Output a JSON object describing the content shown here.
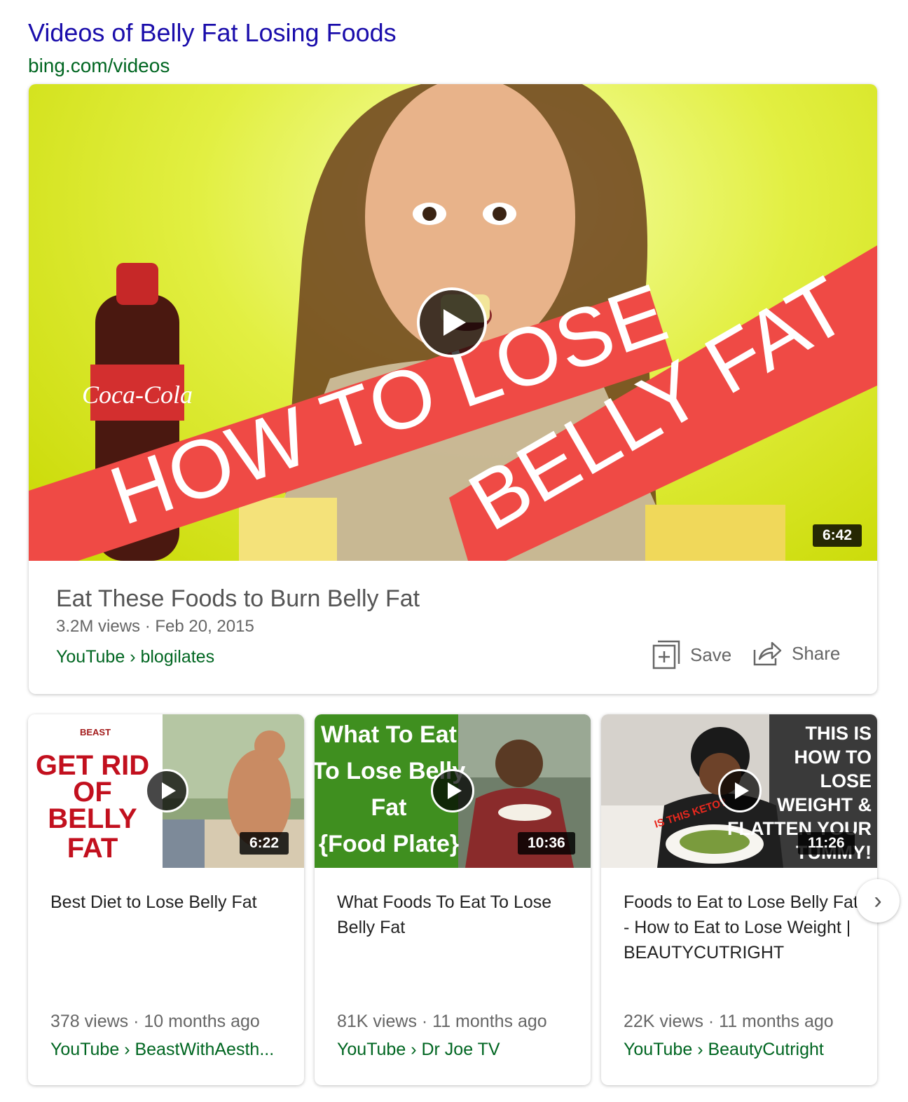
{
  "header": {
    "title": "Videos of Belly Fat Losing Foods",
    "url": "bing.com/videos"
  },
  "featured": {
    "thumb_text_1": "HOW TO LOSE",
    "thumb_text_2": "BELLY FAT",
    "bottle_text": "Coca-Cola",
    "duration": "6:42",
    "title": "Eat These Foods to Burn Belly Fat",
    "meta": "3.2M views · Feb 20, 2015",
    "source": "YouTube › blogilates",
    "save_label": "Save",
    "share_label": "Share"
  },
  "videos": [
    {
      "thumb_lines": [
        "GET RID",
        "OF",
        "BELLY",
        "FAT"
      ],
      "logo_text": "BEAST",
      "duration": "6:22",
      "title": "Best Diet to Lose Belly Fat",
      "meta": "378 views · 10 months ago",
      "source": "YouTube › BeastWithAesth..."
    },
    {
      "thumb_lines": [
        "What To Eat",
        "To Lose Belly",
        "Fat",
        "{Food Plate}"
      ],
      "duration": "10:36",
      "title": "What Foods To Eat To Lose Belly Fat",
      "meta": "81K views · 11 months ago",
      "source": "YouTube › Dr Joe TV"
    },
    {
      "thumb_lines": [
        "THIS IS",
        "HOW TO",
        "LOSE",
        "WEIGHT &",
        "FLATTEN YOUR",
        "TUMMY!"
      ],
      "sticker": "IS THIS KETO?",
      "duration": "11:26",
      "title": "Foods to Eat to Lose Belly Fat - How to Eat to Lose Weight | BEAUTYCUTRIGHT",
      "meta": "22K views · 11 months ago",
      "source": "YouTube › BeautyCutright"
    }
  ],
  "icons": {
    "play": "play-icon",
    "save": "save-icon",
    "share": "share-icon",
    "next": "chevron-right-icon"
  }
}
